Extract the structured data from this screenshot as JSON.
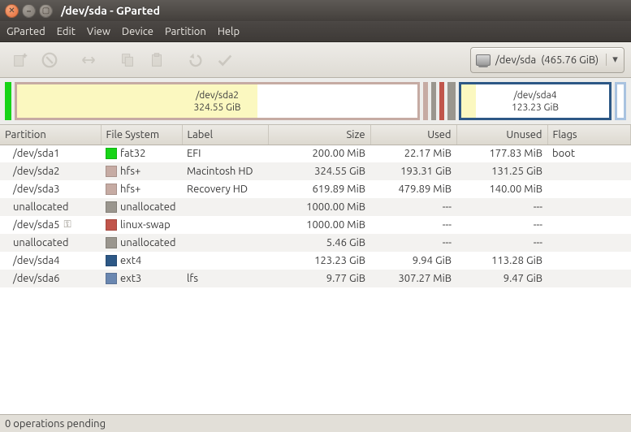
{
  "window": {
    "title": "/dev/sda - GParted"
  },
  "menu": [
    "GParted",
    "Edit",
    "View",
    "Device",
    "Partition",
    "Help"
  ],
  "device_selector": {
    "name": "/dev/sda",
    "size": "(465.76 GiB)"
  },
  "visual": {
    "big1": {
      "label": "/dev/sda2",
      "size": "324.55 GiB"
    },
    "big2": {
      "label": "/dev/sda4",
      "size": "123.23 GiB"
    }
  },
  "colors": {
    "fat32": "#17d417",
    "hfs": "#c6aba3",
    "swap": "#c1554b",
    "unalloc": "#9a968e",
    "ext4": "#2d5886",
    "ext3": "#6a87b0",
    "used_fill": "#fbf8c0",
    "border_ext4": "#2d5886",
    "border_free2": "#a9c3e0"
  },
  "columns": {
    "partition": "Partition",
    "fs": "File System",
    "label": "Label",
    "size": "Size",
    "used": "Used",
    "unused": "Unused",
    "flags": "Flags"
  },
  "rows": [
    {
      "partition": "/dev/sda1",
      "lock": false,
      "fs_color": "#17d417",
      "fs": "fat32",
      "label": "EFI",
      "size": "200.00 MiB",
      "used": "22.17 MiB",
      "unused": "177.83 MiB",
      "flags": "boot"
    },
    {
      "partition": "/dev/sda2",
      "lock": false,
      "fs_color": "#c6aba3",
      "fs": "hfs+",
      "label": "Macintosh HD",
      "size": "324.55 GiB",
      "used": "193.31 GiB",
      "unused": "131.25 GiB",
      "flags": ""
    },
    {
      "partition": "/dev/sda3",
      "lock": false,
      "fs_color": "#c6aba3",
      "fs": "hfs+",
      "label": "Recovery HD",
      "size": "619.89 MiB",
      "used": "479.89 MiB",
      "unused": "140.00 MiB",
      "flags": ""
    },
    {
      "partition": "unallocated",
      "lock": false,
      "fs_color": "#9a968e",
      "fs": "unallocated",
      "label": "",
      "size": "1000.00 MiB",
      "used": "---",
      "unused": "---",
      "flags": ""
    },
    {
      "partition": "/dev/sda5",
      "lock": true,
      "fs_color": "#c1554b",
      "fs": "linux-swap",
      "label": "",
      "size": "1000.00 MiB",
      "used": "---",
      "unused": "---",
      "flags": ""
    },
    {
      "partition": "unallocated",
      "lock": false,
      "fs_color": "#9a968e",
      "fs": "unallocated",
      "label": "",
      "size": "5.46 GiB",
      "used": "---",
      "unused": "---",
      "flags": ""
    },
    {
      "partition": "/dev/sda4",
      "lock": false,
      "fs_color": "#2d5886",
      "fs": "ext4",
      "label": "",
      "size": "123.23 GiB",
      "used": "9.94 GiB",
      "unused": "113.28 GiB",
      "flags": ""
    },
    {
      "partition": "/dev/sda6",
      "lock": false,
      "fs_color": "#6a87b0",
      "fs": "ext3",
      "label": "lfs",
      "size": "9.77 GiB",
      "used": "307.27 MiB",
      "unused": "9.47 GiB",
      "flags": ""
    }
  ],
  "status": "0 operations pending"
}
